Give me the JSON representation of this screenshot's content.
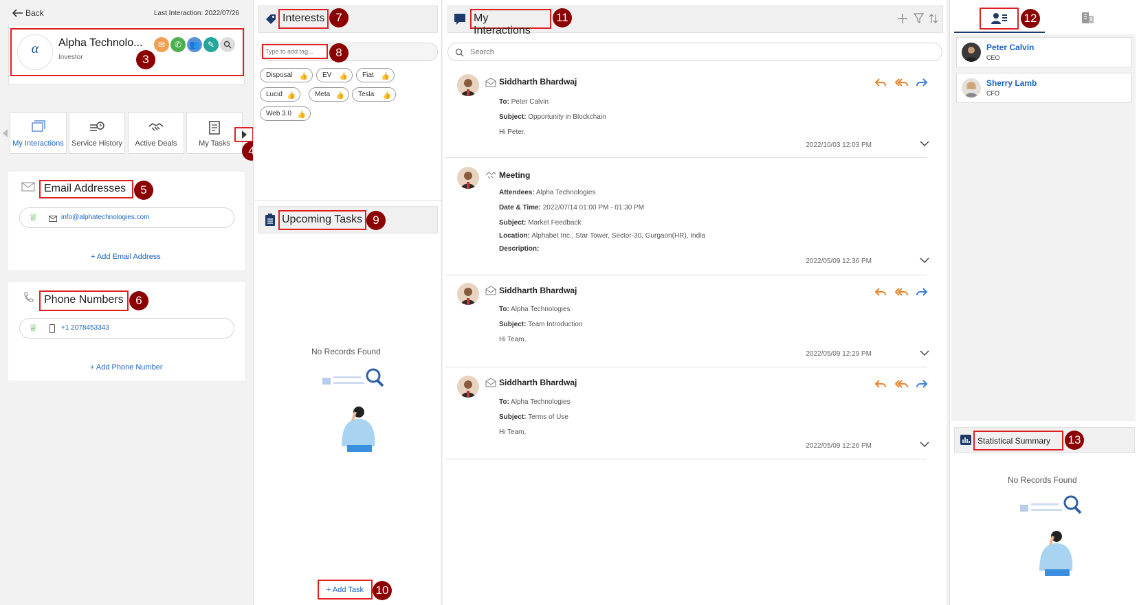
{
  "header": {
    "back_label": "Back",
    "last_interaction": "Last Interaction: 2022/07/26"
  },
  "company": {
    "name": "Alpha Technolo...",
    "role": "Investor",
    "logo_text": "α"
  },
  "nav_tabs": [
    {
      "label": "My Interactions",
      "active": true
    },
    {
      "label": "Service History"
    },
    {
      "label": "Active Deals"
    },
    {
      "label": "My Tasks"
    }
  ],
  "email": {
    "title": "Email Addresses",
    "address": "info@alphatechnologies.com",
    "add_label": "+ Add Email Address"
  },
  "phone": {
    "title": "Phone Numbers",
    "number": "+1 2078453343",
    "add_label": "+ Add Phone Number"
  },
  "interests": {
    "title": "Interests",
    "placeholder": "Type to add tag...",
    "tags": [
      "Disposal",
      "EV",
      "Fiat",
      "Lucid",
      "Meta",
      "Tesla",
      "Web 3.0"
    ]
  },
  "tasks": {
    "title": "Upcoming Tasks",
    "empty": "No Records Found",
    "add_label": "+ Add Task"
  },
  "interactions": {
    "title": "My Interactions",
    "search_placeholder": "Search",
    "items": [
      {
        "name": "Siddharth Bhardwaj",
        "to_label": "To:",
        "to": "Peter Calvin",
        "subject_label": "Subject:",
        "subject": "Opportunity in Blockchain",
        "body": "Hi Peter,",
        "date": "2022/10/03 12:03 PM"
      },
      {
        "name": "Meeting",
        "attendees_label": "Attendees:",
        "attendees": "Alpha Technologies",
        "dt_label": "Date & Time:",
        "dt": "2022/07/14 01:00 PM - 01:30 PM",
        "subject_label": "Subject:",
        "subject": "Market Feedback",
        "location_label": "Location:",
        "location": "Alphabet Inc., Star Tower, Sector-30, Gurgaon(HR), India",
        "desc_label": "Description:",
        "date": "2022/05/09 12:36 PM"
      },
      {
        "name": "Siddharth Bhardwaj",
        "to_label": "To:",
        "to": "Alpha Technologies",
        "subject_label": "Subject:",
        "subject": "Team Introduction",
        "body": "Hi Team,",
        "date": "2022/05/09 12:29 PM"
      },
      {
        "name": "Siddharth Bhardwaj",
        "to_label": "To:",
        "to": "Alpha Technologies",
        "subject_label": "Subject:",
        "subject": "Terms of Use",
        "body": "Hi Team,",
        "date": "2022/05/09 12:26 PM"
      }
    ]
  },
  "contacts": [
    {
      "name": "Peter Calvin",
      "title": "CEO"
    },
    {
      "name": "Sherry Lamb",
      "title": "CFO"
    }
  ],
  "summary": {
    "title": "Statistical Summary",
    "empty": "No Records Found"
  },
  "badges": [
    "3",
    "4",
    "5",
    "6",
    "7",
    "8",
    "9",
    "10",
    "11",
    "12",
    "13"
  ],
  "colors": {
    "accent": "#1a63c4",
    "badge": "#8b0000",
    "annotation": "#e02020",
    "orange": "#e8832a"
  }
}
